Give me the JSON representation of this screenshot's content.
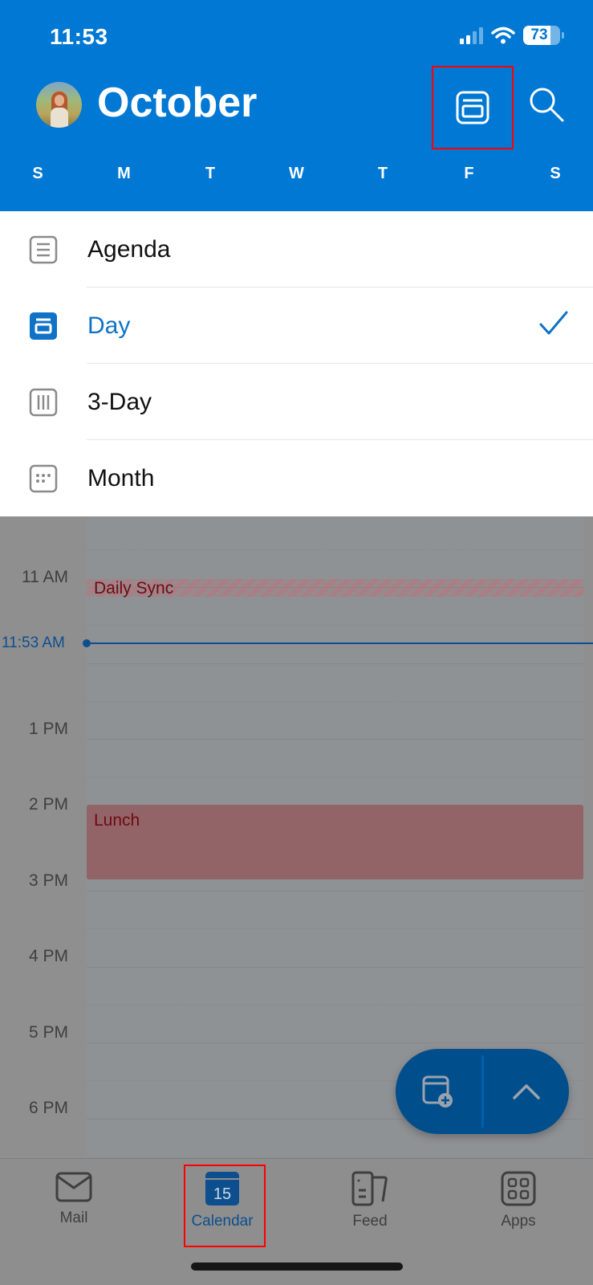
{
  "status_bar": {
    "time": "11:53",
    "battery_percent": "73",
    "battery_level": 0.73,
    "signal_bars_active": 2,
    "signal_bars_total": 4
  },
  "header": {
    "title": "October",
    "avatar_alt": "profile-avatar",
    "view_switcher_icon": "day-view-icon",
    "search_icon": "search-icon",
    "weekdays": [
      "S",
      "M",
      "T",
      "W",
      "T",
      "F",
      "S"
    ]
  },
  "view_menu": {
    "items": [
      {
        "label": "Agenda",
        "icon": "agenda-icon",
        "selected": false
      },
      {
        "label": "Day",
        "icon": "day-view-icon",
        "selected": true
      },
      {
        "label": "3-Day",
        "icon": "three-day-icon",
        "selected": false
      },
      {
        "label": "Month",
        "icon": "month-icon",
        "selected": false
      }
    ]
  },
  "day_view": {
    "hour_labels": [
      "11 AM",
      "1 PM",
      "2 PM",
      "3 PM",
      "4 PM",
      "5 PM",
      "6 PM"
    ],
    "current_time_label": "11:53 AM",
    "events": [
      {
        "title": "Daily Sync",
        "style": "tentative",
        "start": "11:00 AM",
        "end": "11:15 AM"
      },
      {
        "title": "Lunch",
        "style": "busy",
        "start": "2:00 PM",
        "end": "3:00 PM"
      }
    ]
  },
  "fab": {
    "new_event_icon": "calendar-add-icon",
    "expand_icon": "chevron-up-icon"
  },
  "tab_bar": {
    "tabs": [
      {
        "label": "Mail",
        "icon": "mail-icon",
        "active": false
      },
      {
        "label": "Calendar",
        "icon": "calendar-icon",
        "badge": "15",
        "active": true
      },
      {
        "label": "Feed",
        "icon": "feed-icon",
        "active": false
      },
      {
        "label": "Apps",
        "icon": "apps-icon",
        "active": false
      }
    ]
  },
  "colors": {
    "brand_blue": "#0078d4",
    "selected_text": "#0f72c7",
    "event_red": "#6e0b12",
    "fab_blue": "#004e8c"
  }
}
